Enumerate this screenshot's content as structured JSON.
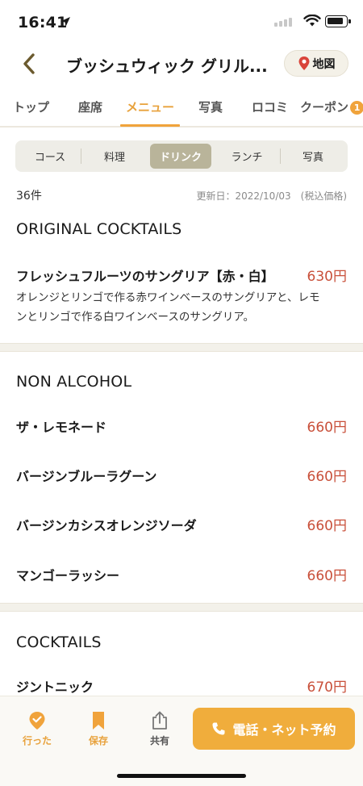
{
  "status": {
    "time": "16:41"
  },
  "header": {
    "title": "ブッシュウィック グリル...",
    "map_label": "地図"
  },
  "tabs": [
    {
      "label": "トップ"
    },
    {
      "label": "座席"
    },
    {
      "label": "メニュー",
      "active": true
    },
    {
      "label": "写真"
    },
    {
      "label": "ロコミ"
    },
    {
      "label": "クーポン",
      "badge": "1"
    }
  ],
  "segments": [
    {
      "label": "コース"
    },
    {
      "label": "料理"
    },
    {
      "label": "ドリンク",
      "active": true
    },
    {
      "label": "ランチ"
    },
    {
      "label": "写真"
    }
  ],
  "summary": {
    "count": "36件",
    "updated": "更新日：2022/10/03　(税込価格)"
  },
  "sections": [
    {
      "title": "ORIGINAL COCKTAILS",
      "items": [
        {
          "name": "フレッシュフルーツのサングリア【赤・白】",
          "price": "630円",
          "desc_lines": [
            "オレンジとリンゴで作る赤ワインベースのサングリアと、レモ",
            "ンとリンゴで作る白ワインベースのサングリア。"
          ]
        }
      ]
    },
    {
      "title": "NON ALCOHOL",
      "items": [
        {
          "name": "ザ・レモネード",
          "price": "660円"
        },
        {
          "name": "バージンブルーラグーン",
          "price": "660円"
        },
        {
          "name": "バージンカシスオレンジソーダ",
          "price": "660円"
        },
        {
          "name": "マンゴーラッシー",
          "price": "660円"
        }
      ]
    },
    {
      "title": "COCKTAILS",
      "items": [
        {
          "name": "ジントニック",
          "price": "670円"
        }
      ]
    }
  ],
  "bottom": {
    "visited_label": "行った",
    "save_label": "保存",
    "share_label": "共有",
    "reserve_label": "電話・ネット予約"
  },
  "colors": {
    "accent": "#f0a33b",
    "price": "#c9503a",
    "segment_active": "#b9b49a"
  }
}
